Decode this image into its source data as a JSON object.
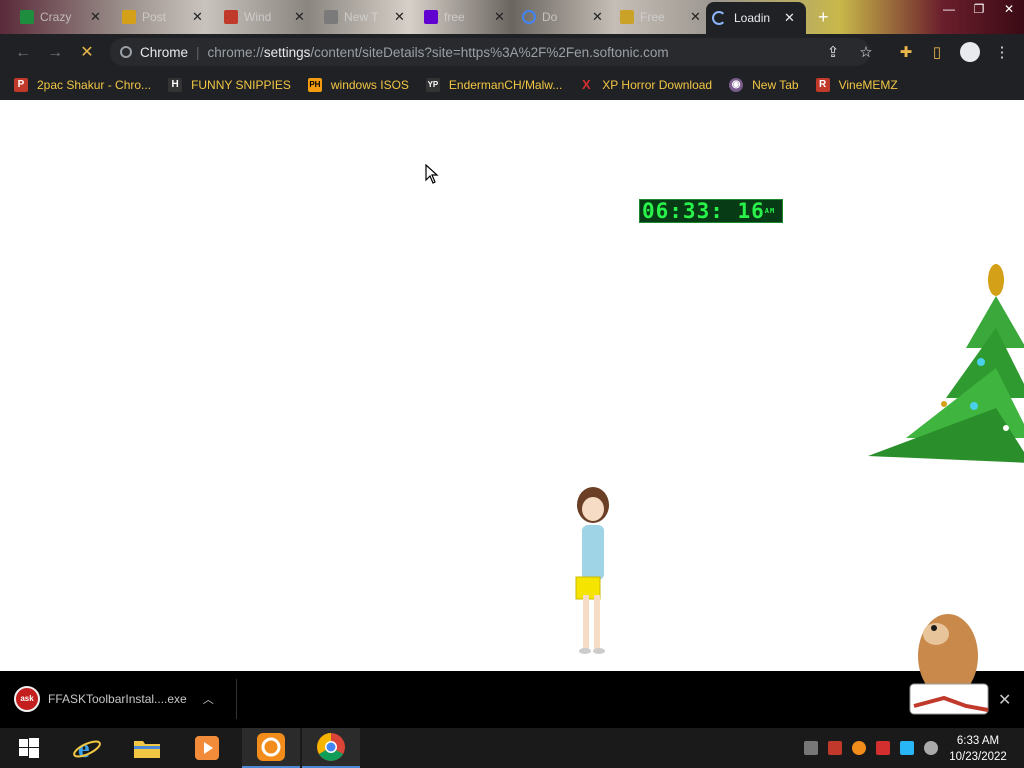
{
  "tabs": [
    {
      "title": "Crazy"
    },
    {
      "title": "Post"
    },
    {
      "title": "Wind"
    },
    {
      "title": "New T"
    },
    {
      "title": "free"
    },
    {
      "title": "Do"
    },
    {
      "title": "Free"
    },
    {
      "title": "Loadin"
    }
  ],
  "omnibox": {
    "label": "Chrome",
    "url_prefix": "chrome://",
    "url_bold": "settings",
    "url_rest": "/content/siteDetails?site=https%3A%2F%2Fen.softonic.com"
  },
  "bookmarks": [
    {
      "label": "2pac Shakur - Chro...",
      "icon": "P",
      "color": "#c0392b"
    },
    {
      "label": "FUNNY SNIPPIES",
      "icon": "H",
      "color": "#333333"
    },
    {
      "label": "windows ISOS",
      "icon": "PH",
      "color": "#f39c12"
    },
    {
      "label": "EndermanCH/Malw...",
      "icon": "YP",
      "color": "#333333"
    },
    {
      "label": "XP Horror Download",
      "icon": "X",
      "color": "#d32f2f"
    },
    {
      "label": "New Tab",
      "icon": "◉",
      "color": "#7a5c8c"
    },
    {
      "label": "VineMEMZ",
      "icon": "R",
      "color": "#c0392b"
    }
  ],
  "page": {
    "clock_time": "06:33: 16",
    "clock_ampm": "AM"
  },
  "download": {
    "filename": "FFASKToolbarInstal....exe",
    "icon_label": "ask"
  },
  "taskbar": {
    "time": "6:33 AM",
    "date": "10/23/2022"
  }
}
